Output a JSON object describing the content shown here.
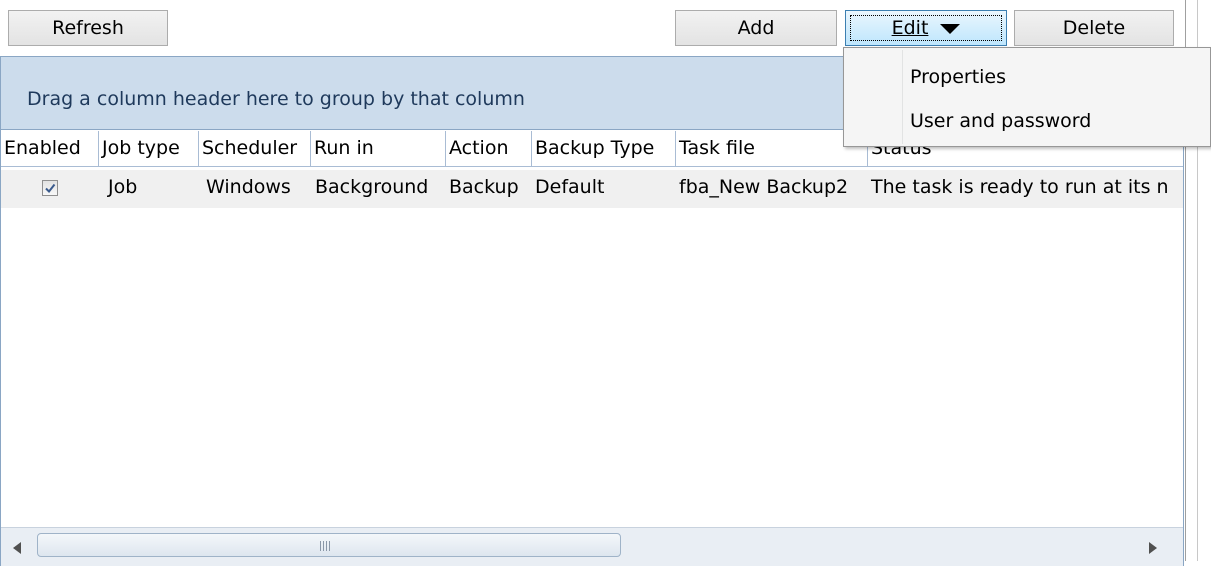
{
  "toolbar": {
    "refresh_label": "Refresh",
    "add_label": "Add",
    "edit_label": "Edit",
    "delete_label": "Delete"
  },
  "grid": {
    "group_panel_text": "Drag a column header here to group by that column",
    "columns": [
      "Enabled",
      "Job type",
      "Scheduler",
      "Run in",
      "Action",
      "Backup Type",
      "Task file",
      "Status"
    ],
    "rows": [
      {
        "enabled": true,
        "job_type": "Job",
        "scheduler": "Windows",
        "run_in": "Background",
        "action": "Backup",
        "backup_type": "Default",
        "task_file": "fba_New Backup2",
        "status": "The task is ready to run at its n"
      }
    ]
  },
  "edit_menu": {
    "items": [
      "Properties",
      "User and password"
    ]
  },
  "icons": {
    "edit_dropdown": "triangle-down-icon",
    "scroll_left": "triangle-left-icon",
    "scroll_right": "triangle-right-icon",
    "checkbox": "checkmark-icon"
  },
  "colors": {
    "group_panel_bg": "#ccdcec",
    "group_panel_text": "#1e395b",
    "grid_border": "#8aa6c4",
    "row_bg": "#f0f0f0",
    "menu_bg": "#f5f5f5",
    "edit_button_active": "#bee6fd"
  }
}
